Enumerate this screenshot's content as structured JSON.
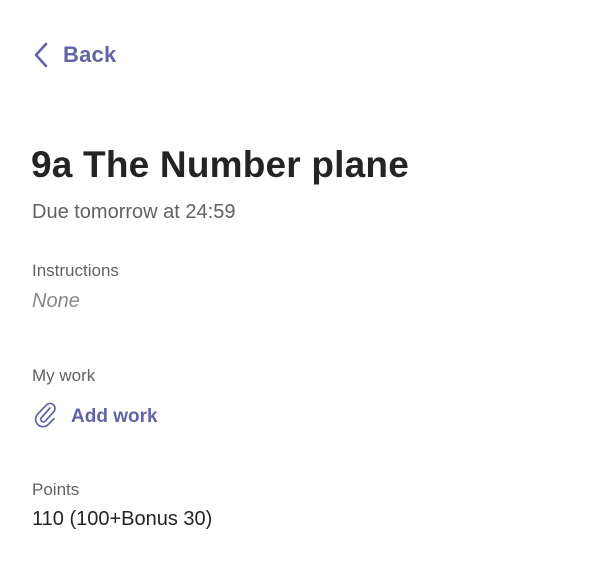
{
  "nav": {
    "back_icon": "chevron-left-icon",
    "back_label": "Back"
  },
  "assignment": {
    "title": "9a The Number plane",
    "due": "Due tomorrow at 24:59"
  },
  "instructions": {
    "label": "Instructions",
    "value": "None"
  },
  "my_work": {
    "label": "My work",
    "add_icon": "paperclip-icon",
    "add_label": "Add work"
  },
  "points": {
    "label": "Points",
    "value": "110 (100+Bonus 30)"
  },
  "colors": {
    "accent": "#6264a7",
    "text_primary": "#242424",
    "text_secondary": "#616161",
    "text_muted": "#8a8886",
    "background": "#ffffff"
  }
}
